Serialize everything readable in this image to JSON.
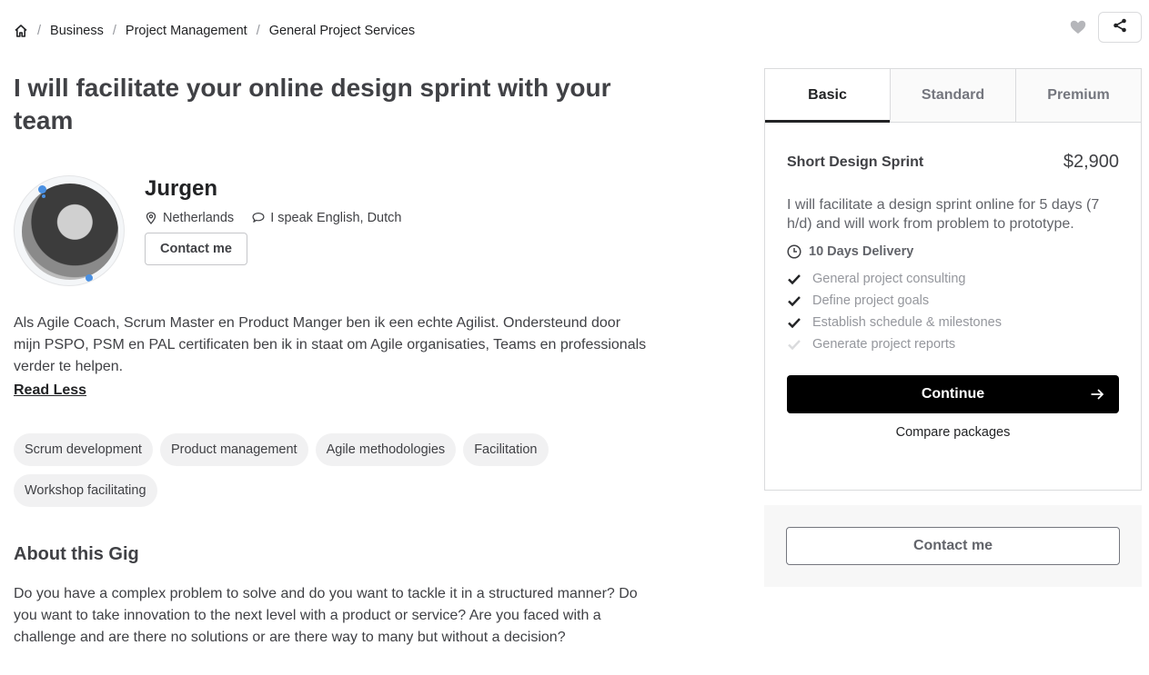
{
  "breadcrumb": {
    "home_icon": "home-icon",
    "items": [
      "Business",
      "Project Management",
      "General Project Services"
    ],
    "separator": "/"
  },
  "actions": {
    "like_icon": "heart-icon",
    "share_icon": "share-icon"
  },
  "gig": {
    "title": "I will facilitate your online design sprint with your team"
  },
  "seller": {
    "name": "Jurgen",
    "country": "Netherlands",
    "languages": "I speak English, Dutch",
    "contact_label": "Contact me",
    "bio": "Als Agile Coach, Scrum Master en Product Manger ben ik een echte Agilist. Ondersteund door mijn PSPO, PSM en PAL certificaten ben ik in staat om Agile organisaties, Teams en professionals verder te helpen.",
    "read_less": "Read Less"
  },
  "tags": [
    "Scrum development",
    "Product management",
    "Agile methodologies",
    "Facilitation",
    "Workshop facilitating"
  ],
  "about": {
    "heading": "About this Gig",
    "text": "Do you have a complex problem to solve and do you want to tackle it in a structured manner? Do you want to take innovation to the next level with a product or service? Are you faced with a challenge and are there no solutions or are there way to many but without a decision?"
  },
  "package": {
    "tabs": [
      "Basic",
      "Standard",
      "Premium"
    ],
    "active_tab": "Basic",
    "name": "Short Design Sprint",
    "price": "$2,900",
    "description": "I will facilitate a design sprint online for 5 days (7 h/d) and will work from problem to prototype.",
    "delivery": "10 Days Delivery",
    "features": [
      {
        "label": "General project consulting",
        "included": true
      },
      {
        "label": "Define project goals",
        "included": true
      },
      {
        "label": "Establish schedule & milestones",
        "included": true
      },
      {
        "label": "Generate project reports",
        "included": false
      }
    ],
    "continue_label": "Continue",
    "compare_label": "Compare packages"
  },
  "contact_panel": {
    "label": "Contact me"
  },
  "colors": {
    "text": "#404145",
    "dark": "#222325",
    "muted": "#95979d",
    "border": "#dadbdd",
    "button": "#000000",
    "avatar_accent": "#4a90e2"
  }
}
